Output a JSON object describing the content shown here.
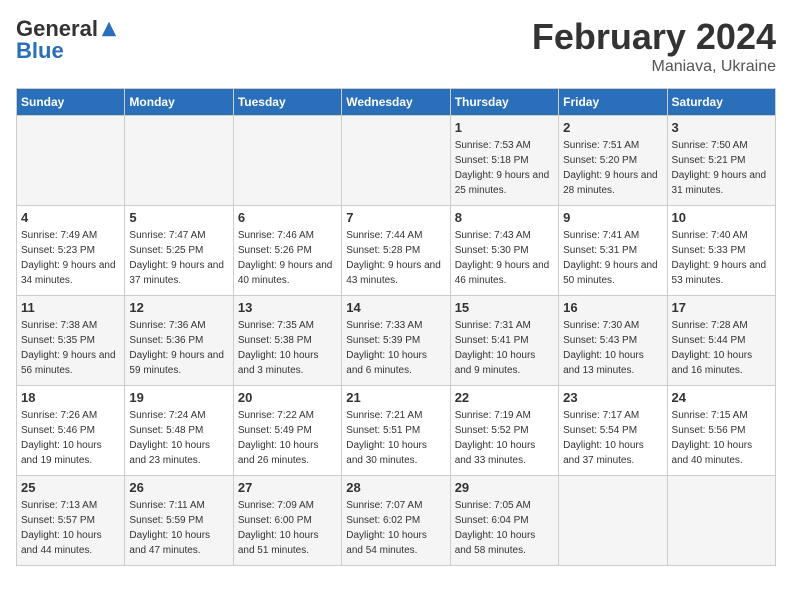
{
  "logo": {
    "general": "General",
    "blue": "Blue"
  },
  "header": {
    "month": "February 2024",
    "location": "Maniava, Ukraine"
  },
  "weekdays": [
    "Sunday",
    "Monday",
    "Tuesday",
    "Wednesday",
    "Thursday",
    "Friday",
    "Saturday"
  ],
  "weeks": [
    [
      {
        "day": "",
        "sunrise": "",
        "sunset": "",
        "daylight": ""
      },
      {
        "day": "",
        "sunrise": "",
        "sunset": "",
        "daylight": ""
      },
      {
        "day": "",
        "sunrise": "",
        "sunset": "",
        "daylight": ""
      },
      {
        "day": "",
        "sunrise": "",
        "sunset": "",
        "daylight": ""
      },
      {
        "day": "1",
        "sunrise": "Sunrise: 7:53 AM",
        "sunset": "Sunset: 5:18 PM",
        "daylight": "Daylight: 9 hours and 25 minutes."
      },
      {
        "day": "2",
        "sunrise": "Sunrise: 7:51 AM",
        "sunset": "Sunset: 5:20 PM",
        "daylight": "Daylight: 9 hours and 28 minutes."
      },
      {
        "day": "3",
        "sunrise": "Sunrise: 7:50 AM",
        "sunset": "Sunset: 5:21 PM",
        "daylight": "Daylight: 9 hours and 31 minutes."
      }
    ],
    [
      {
        "day": "4",
        "sunrise": "Sunrise: 7:49 AM",
        "sunset": "Sunset: 5:23 PM",
        "daylight": "Daylight: 9 hours and 34 minutes."
      },
      {
        "day": "5",
        "sunrise": "Sunrise: 7:47 AM",
        "sunset": "Sunset: 5:25 PM",
        "daylight": "Daylight: 9 hours and 37 minutes."
      },
      {
        "day": "6",
        "sunrise": "Sunrise: 7:46 AM",
        "sunset": "Sunset: 5:26 PM",
        "daylight": "Daylight: 9 hours and 40 minutes."
      },
      {
        "day": "7",
        "sunrise": "Sunrise: 7:44 AM",
        "sunset": "Sunset: 5:28 PM",
        "daylight": "Daylight: 9 hours and 43 minutes."
      },
      {
        "day": "8",
        "sunrise": "Sunrise: 7:43 AM",
        "sunset": "Sunset: 5:30 PM",
        "daylight": "Daylight: 9 hours and 46 minutes."
      },
      {
        "day": "9",
        "sunrise": "Sunrise: 7:41 AM",
        "sunset": "Sunset: 5:31 PM",
        "daylight": "Daylight: 9 hours and 50 minutes."
      },
      {
        "day": "10",
        "sunrise": "Sunrise: 7:40 AM",
        "sunset": "Sunset: 5:33 PM",
        "daylight": "Daylight: 9 hours and 53 minutes."
      }
    ],
    [
      {
        "day": "11",
        "sunrise": "Sunrise: 7:38 AM",
        "sunset": "Sunset: 5:35 PM",
        "daylight": "Daylight: 9 hours and 56 minutes."
      },
      {
        "day": "12",
        "sunrise": "Sunrise: 7:36 AM",
        "sunset": "Sunset: 5:36 PM",
        "daylight": "Daylight: 9 hours and 59 minutes."
      },
      {
        "day": "13",
        "sunrise": "Sunrise: 7:35 AM",
        "sunset": "Sunset: 5:38 PM",
        "daylight": "Daylight: 10 hours and 3 minutes."
      },
      {
        "day": "14",
        "sunrise": "Sunrise: 7:33 AM",
        "sunset": "Sunset: 5:39 PM",
        "daylight": "Daylight: 10 hours and 6 minutes."
      },
      {
        "day": "15",
        "sunrise": "Sunrise: 7:31 AM",
        "sunset": "Sunset: 5:41 PM",
        "daylight": "Daylight: 10 hours and 9 minutes."
      },
      {
        "day": "16",
        "sunrise": "Sunrise: 7:30 AM",
        "sunset": "Sunset: 5:43 PM",
        "daylight": "Daylight: 10 hours and 13 minutes."
      },
      {
        "day": "17",
        "sunrise": "Sunrise: 7:28 AM",
        "sunset": "Sunset: 5:44 PM",
        "daylight": "Daylight: 10 hours and 16 minutes."
      }
    ],
    [
      {
        "day": "18",
        "sunrise": "Sunrise: 7:26 AM",
        "sunset": "Sunset: 5:46 PM",
        "daylight": "Daylight: 10 hours and 19 minutes."
      },
      {
        "day": "19",
        "sunrise": "Sunrise: 7:24 AM",
        "sunset": "Sunset: 5:48 PM",
        "daylight": "Daylight: 10 hours and 23 minutes."
      },
      {
        "day": "20",
        "sunrise": "Sunrise: 7:22 AM",
        "sunset": "Sunset: 5:49 PM",
        "daylight": "Daylight: 10 hours and 26 minutes."
      },
      {
        "day": "21",
        "sunrise": "Sunrise: 7:21 AM",
        "sunset": "Sunset: 5:51 PM",
        "daylight": "Daylight: 10 hours and 30 minutes."
      },
      {
        "day": "22",
        "sunrise": "Sunrise: 7:19 AM",
        "sunset": "Sunset: 5:52 PM",
        "daylight": "Daylight: 10 hours and 33 minutes."
      },
      {
        "day": "23",
        "sunrise": "Sunrise: 7:17 AM",
        "sunset": "Sunset: 5:54 PM",
        "daylight": "Daylight: 10 hours and 37 minutes."
      },
      {
        "day": "24",
        "sunrise": "Sunrise: 7:15 AM",
        "sunset": "Sunset: 5:56 PM",
        "daylight": "Daylight: 10 hours and 40 minutes."
      }
    ],
    [
      {
        "day": "25",
        "sunrise": "Sunrise: 7:13 AM",
        "sunset": "Sunset: 5:57 PM",
        "daylight": "Daylight: 10 hours and 44 minutes."
      },
      {
        "day": "26",
        "sunrise": "Sunrise: 7:11 AM",
        "sunset": "Sunset: 5:59 PM",
        "daylight": "Daylight: 10 hours and 47 minutes."
      },
      {
        "day": "27",
        "sunrise": "Sunrise: 7:09 AM",
        "sunset": "Sunset: 6:00 PM",
        "daylight": "Daylight: 10 hours and 51 minutes."
      },
      {
        "day": "28",
        "sunrise": "Sunrise: 7:07 AM",
        "sunset": "Sunset: 6:02 PM",
        "daylight": "Daylight: 10 hours and 54 minutes."
      },
      {
        "day": "29",
        "sunrise": "Sunrise: 7:05 AM",
        "sunset": "Sunset: 6:04 PM",
        "daylight": "Daylight: 10 hours and 58 minutes."
      },
      {
        "day": "",
        "sunrise": "",
        "sunset": "",
        "daylight": ""
      },
      {
        "day": "",
        "sunrise": "",
        "sunset": "",
        "daylight": ""
      }
    ]
  ]
}
